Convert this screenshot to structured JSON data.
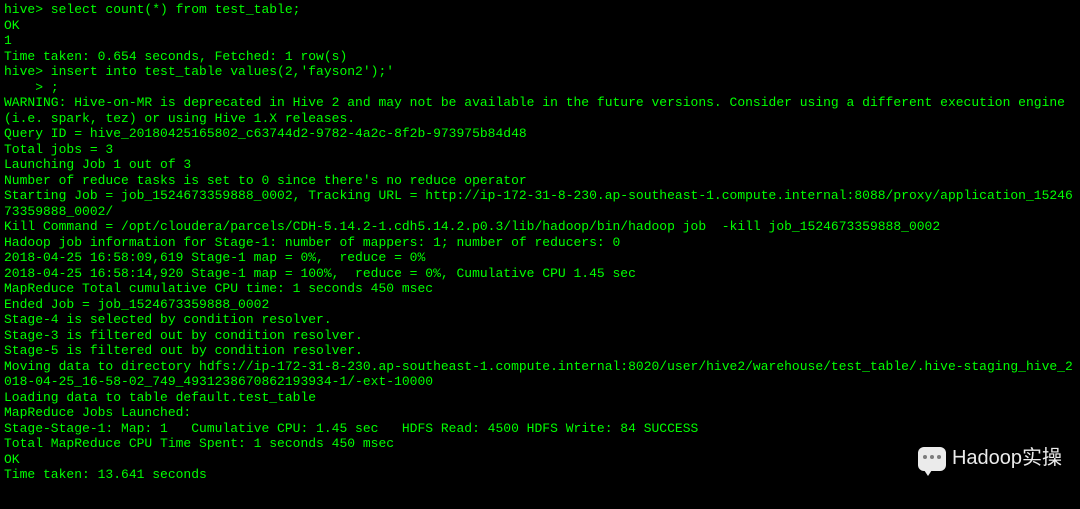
{
  "terminal": {
    "lines": [
      "hive> select count(*) from test_table;",
      "OK",
      "1",
      "Time taken: 0.654 seconds, Fetched: 1 row(s)",
      "hive> insert into test_table values(2,'fayson2');'",
      "    > ;",
      "WARNING: Hive-on-MR is deprecated in Hive 2 and may not be available in the future versions. Consider using a different execution engine (i.e. spark, tez) or using Hive 1.X releases.",
      "Query ID = hive_20180425165802_c63744d2-9782-4a2c-8f2b-973975b84d48",
      "Total jobs = 3",
      "Launching Job 1 out of 3",
      "Number of reduce tasks is set to 0 since there's no reduce operator",
      "Starting Job = job_1524673359888_0002, Tracking URL = http://ip-172-31-8-230.ap-southeast-1.compute.internal:8088/proxy/application_1524673359888_0002/",
      "Kill Command = /opt/cloudera/parcels/CDH-5.14.2-1.cdh5.14.2.p0.3/lib/hadoop/bin/hadoop job  -kill job_1524673359888_0002",
      "Hadoop job information for Stage-1: number of mappers: 1; number of reducers: 0",
      "2018-04-25 16:58:09,619 Stage-1 map = 0%,  reduce = 0%",
      "2018-04-25 16:58:14,920 Stage-1 map = 100%,  reduce = 0%, Cumulative CPU 1.45 sec",
      "MapReduce Total cumulative CPU time: 1 seconds 450 msec",
      "Ended Job = job_1524673359888_0002",
      "Stage-4 is selected by condition resolver.",
      "Stage-3 is filtered out by condition resolver.",
      "Stage-5 is filtered out by condition resolver.",
      "Moving data to directory hdfs://ip-172-31-8-230.ap-southeast-1.compute.internal:8020/user/hive2/warehouse/test_table/.hive-staging_hive_2018-04-25_16-58-02_749_4931238670862193934-1/-ext-10000",
      "Loading data to table default.test_table",
      "MapReduce Jobs Launched:",
      "Stage-Stage-1: Map: 1   Cumulative CPU: 1.45 sec   HDFS Read: 4500 HDFS Write: 84 SUCCESS",
      "Total MapReduce CPU Time Spent: 1 seconds 450 msec",
      "OK",
      "Time taken: 13.641 seconds"
    ]
  },
  "watermark": {
    "text": "Hadoop实操"
  }
}
